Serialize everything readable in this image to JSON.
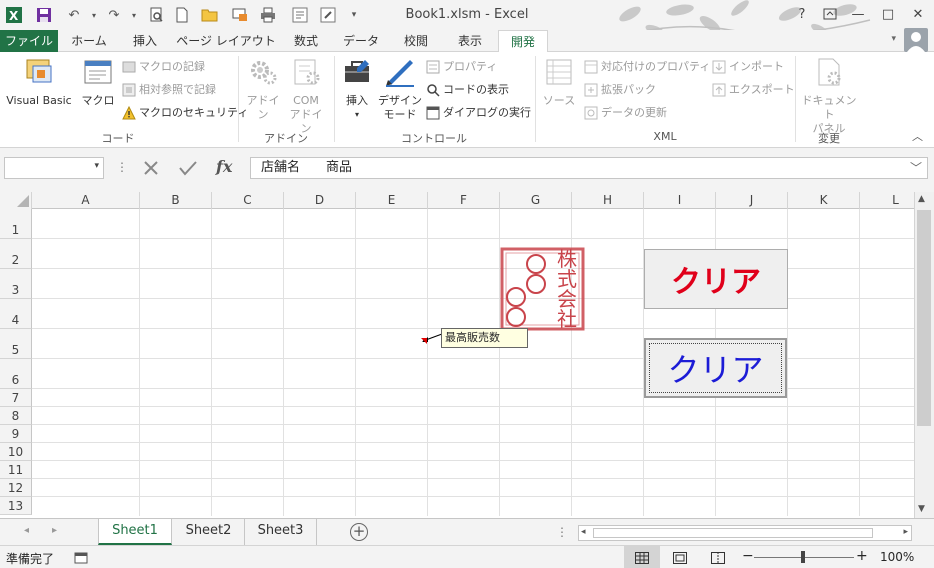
{
  "window": {
    "title": "Book1.xlsm - Excel",
    "help": "?",
    "minimize": "—",
    "restore": "□",
    "close": "✕"
  },
  "tabs": [
    "ファイル",
    "ホーム",
    "挿入",
    "ページ レイアウト",
    "数式",
    "データ",
    "校閲",
    "表示",
    "開発"
  ],
  "ribbon": {
    "code": {
      "visual_basic": "Visual Basic",
      "macro": "マクロ",
      "record_macro": "マクロの記録",
      "relative_ref": "相対参照で記録",
      "macro_security": "マクロのセキュリティ",
      "label": "コード"
    },
    "addins": {
      "addin": "アドイン",
      "com_1": "COM",
      "com_2": "アドイン",
      "label": "アドイン"
    },
    "controls": {
      "insert": "挿入",
      "design_1": "デザイン",
      "design_2": "モード",
      "properties": "プロパティ",
      "view_code": "コードの表示",
      "run_dialog": "ダイアログの実行",
      "label": "コントロール"
    },
    "xml": {
      "source": "ソース",
      "map_props": "対応付けのプロパティ",
      "expansion": "拡張パック",
      "refresh": "データの更新",
      "import": "インポート",
      "export": "エクスポート",
      "label": "XML"
    },
    "modify": {
      "doc_1": "ドキュメント",
      "doc_2": "パネル",
      "label": "変更"
    }
  },
  "formula_bar": {
    "name_box": "",
    "fx": "fx",
    "content": "店舗名　　商品"
  },
  "grid": {
    "columns": [
      "A",
      "B",
      "C",
      "D",
      "E",
      "F",
      "G",
      "H",
      "I",
      "J",
      "K",
      "L"
    ],
    "rows": [
      "1",
      "2",
      "3",
      "4",
      "5",
      "6",
      "7",
      "8",
      "9",
      "10",
      "11",
      "12",
      "13"
    ]
  },
  "stamp": {
    "text": [
      "株",
      "式",
      "会",
      "社"
    ]
  },
  "buttons": {
    "clear_1": "クリア",
    "clear_2": "クリア"
  },
  "comment": {
    "text": "最高販売数"
  },
  "sheets": [
    "Sheet1",
    "Sheet2",
    "Sheet3"
  ],
  "status": {
    "ready": "準備完了",
    "zoom": "100%"
  },
  "colors": {
    "excel_green": "#217346",
    "stamp_red": "#c9444b",
    "btn1_text": "#e0001a",
    "btn2_text": "#1c1cd6"
  }
}
